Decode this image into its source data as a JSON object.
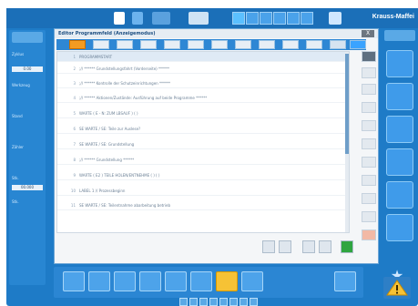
{
  "window": {
    "title": "Editor Programmfeld (Anzeigemodus)",
    "close_label": "X"
  },
  "code_lines": [
    {
      "num": "1",
      "text": "PROGRAMMSTART"
    },
    {
      "num": "2",
      "text": ";// ****** Grundstellungsfahrt (Vorderseite) ******"
    },
    {
      "num": "3",
      "text": ";// ****** Kontrolle der Schutzeinrichtungen ******"
    },
    {
      "num": "4",
      "text": ";// ****** Aktionen/Zustände: Ausführung auf beide Programme ******"
    },
    {
      "num": "5",
      "text": "WARTE ( E - N: ZUM LBSAUF ) ( )"
    },
    {
      "num": "6",
      "text": "SE WARTE / SE: Teile zur Auslese?"
    },
    {
      "num": "7",
      "text": "SE WARTE / SE: Grundstellung"
    },
    {
      "num": "8",
      "text": ";// ****** Grundstellung ******"
    },
    {
      "num": "9",
      "text": "WARTE ( E2 ) TEILE HOLEN/ENTNEHME ( ) ( )"
    },
    {
      "num": "10",
      "text": "LABEL 1 // Prozessbeginn"
    },
    {
      "num": "11",
      "text": "SE WARTE / SE: Teilentnahme abarbeitung betrieb"
    }
  ],
  "brand": "Krauss-Maffei",
  "left_panel": {
    "labels": [
      "Zyklus",
      "Werkzeug",
      "Stand",
      "Zähler",
      "Stk.",
      "Stk."
    ],
    "values": [
      "0.00",
      "00.000"
    ]
  },
  "colors": {
    "accent": "#1e7bc7",
    "active_tab": "#f39b21",
    "active_tool": "#f6c235"
  }
}
